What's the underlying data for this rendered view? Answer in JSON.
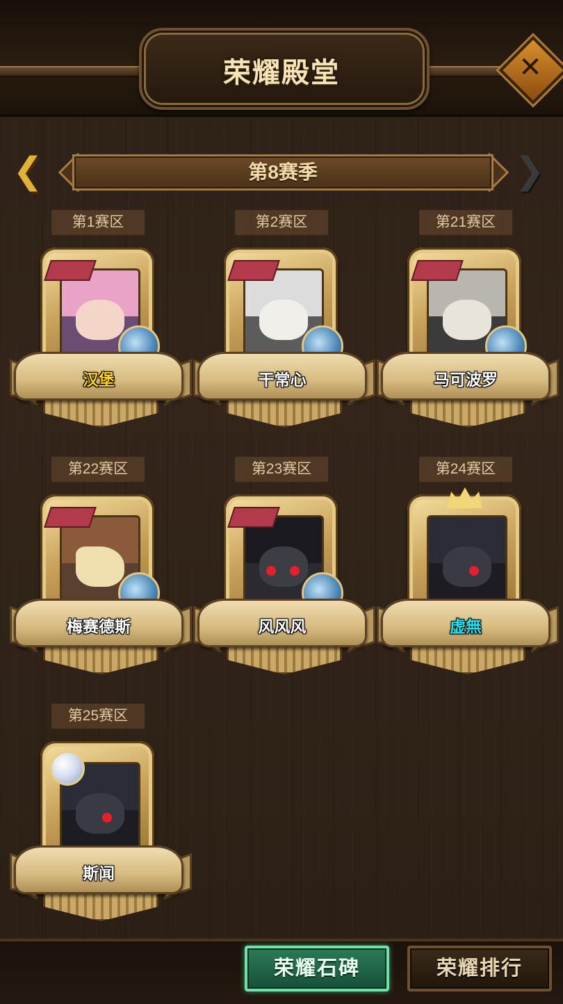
{
  "header": {
    "title": "荣耀殿堂",
    "close_icon": "close-x-icon"
  },
  "season": {
    "label": "第8赛季",
    "prev_icon": "chevron-left-icon",
    "next_icon": "chevron-right-icon"
  },
  "zones": [
    {
      "zone": "第1赛区",
      "name": "汉堡",
      "name_color": "#ffd21f",
      "portrait": "pink-hair-hooded-hero"
    },
    {
      "zone": "第2赛区",
      "name": "干常心",
      "name_color": "#ffffff",
      "portrait": "white-hair-hero"
    },
    {
      "zone": "第21赛区",
      "name": "马可波罗",
      "name_color": "#ffffff",
      "portrait": "panda-robot-hero"
    },
    {
      "zone": "第22赛区",
      "name": "梅赛德斯",
      "name_color": "#ffffff",
      "portrait": "mask-hero"
    },
    {
      "zone": "第23赛区",
      "name": "风风风",
      "name_color": "#ffffff",
      "portrait": "dark-hat-red-eye-hero"
    },
    {
      "zone": "第24赛区",
      "name": "虚無",
      "name_color": "#27e0f0",
      "portrait": "black-dragon-hero"
    },
    {
      "zone": "第25赛区",
      "name": "斯闻",
      "name_color": "#ffffff",
      "portrait": "black-dragon-hero"
    }
  ],
  "bottom": {
    "stele_label": "荣耀石碑",
    "rank_label": "荣耀排行"
  },
  "colors": {
    "accent_gold": "#e2b13a",
    "active_green": "#2c7a56"
  }
}
